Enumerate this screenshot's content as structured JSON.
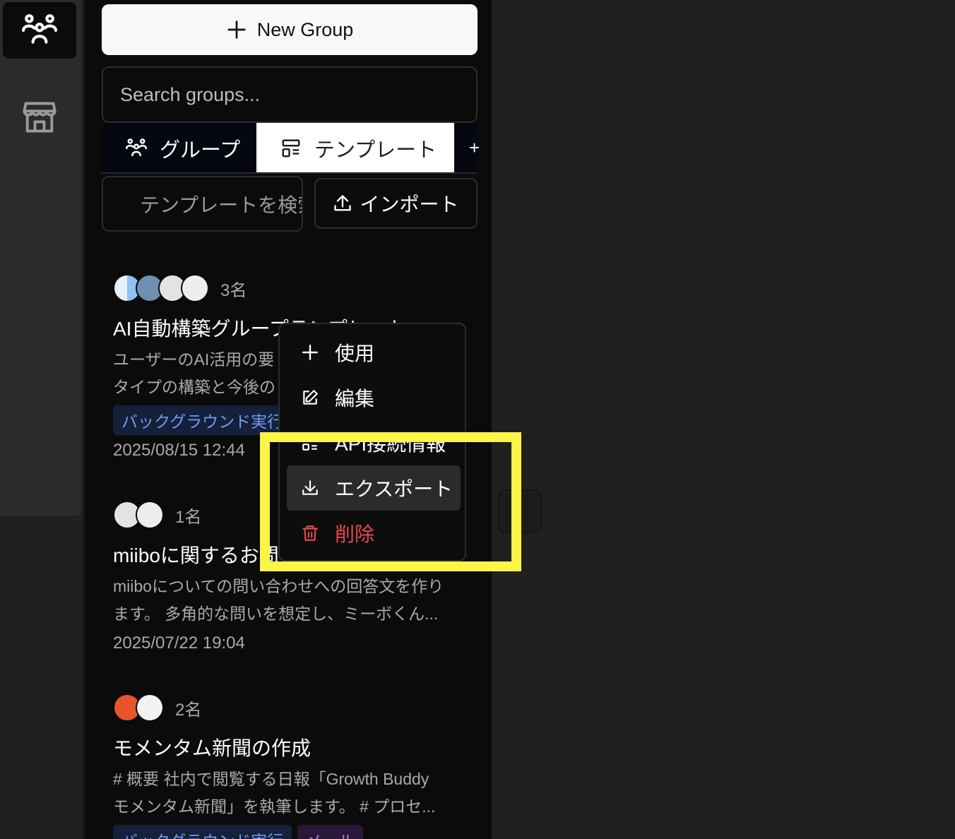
{
  "rail": {
    "groups_icon": "groups-icon",
    "store_icon": "store-icon"
  },
  "new_group": {
    "label": "New Group"
  },
  "search_groups": {
    "placeholder": "Search groups..."
  },
  "tabs": [
    {
      "label": "グループ",
      "icon": "groups-icon"
    },
    {
      "label": "テンプレート",
      "icon": "template-icon"
    }
  ],
  "tabs_add": "+",
  "template_search": {
    "placeholder": "テンプレートを検索"
  },
  "import": {
    "label": "インポート"
  },
  "cards": [
    {
      "count": "3名",
      "title": "AI自動構築グループテンプレート",
      "desc": [
        "ユーザーのAI活用の要",
        "タイプの構築と今後の"
      ],
      "tags": [
        "バックグラウンド実行"
      ],
      "date": "2025/08/15 12:44"
    },
    {
      "count": "1名",
      "title": "miiboに関するお問い合わせ",
      "desc": [
        "miiboについての問い合わせへの回答文を作り",
        "ます。 多角的な問いを想定し、ミーボくん..."
      ],
      "tags": [],
      "date": "2025/07/22 19:04"
    },
    {
      "count": "2名",
      "title": "モメンタム新聞の作成",
      "desc": [
        "# 概要 社内で閲覧する日報「Growth Buddy",
        "モメンタム新聞」を執筆します。 # プロセ..."
      ],
      "tags": [
        "バックグラウンド実行",
        "メール"
      ],
      "date": ""
    }
  ],
  "context_menu": [
    {
      "label": "使用",
      "icon": "plus-icon"
    },
    {
      "label": "編集",
      "icon": "edit-icon"
    },
    {
      "label": "API接続情報",
      "icon": "api-info-icon"
    },
    {
      "label": "エクスポート",
      "icon": "download-icon"
    },
    {
      "label": "削除",
      "icon": "trash-icon"
    }
  ],
  "colors": {
    "highlight": "#fbf549",
    "danger": "#e5484d",
    "tag_background_text": "#6e9cf5",
    "tag_mail_text": "#b27be0"
  }
}
